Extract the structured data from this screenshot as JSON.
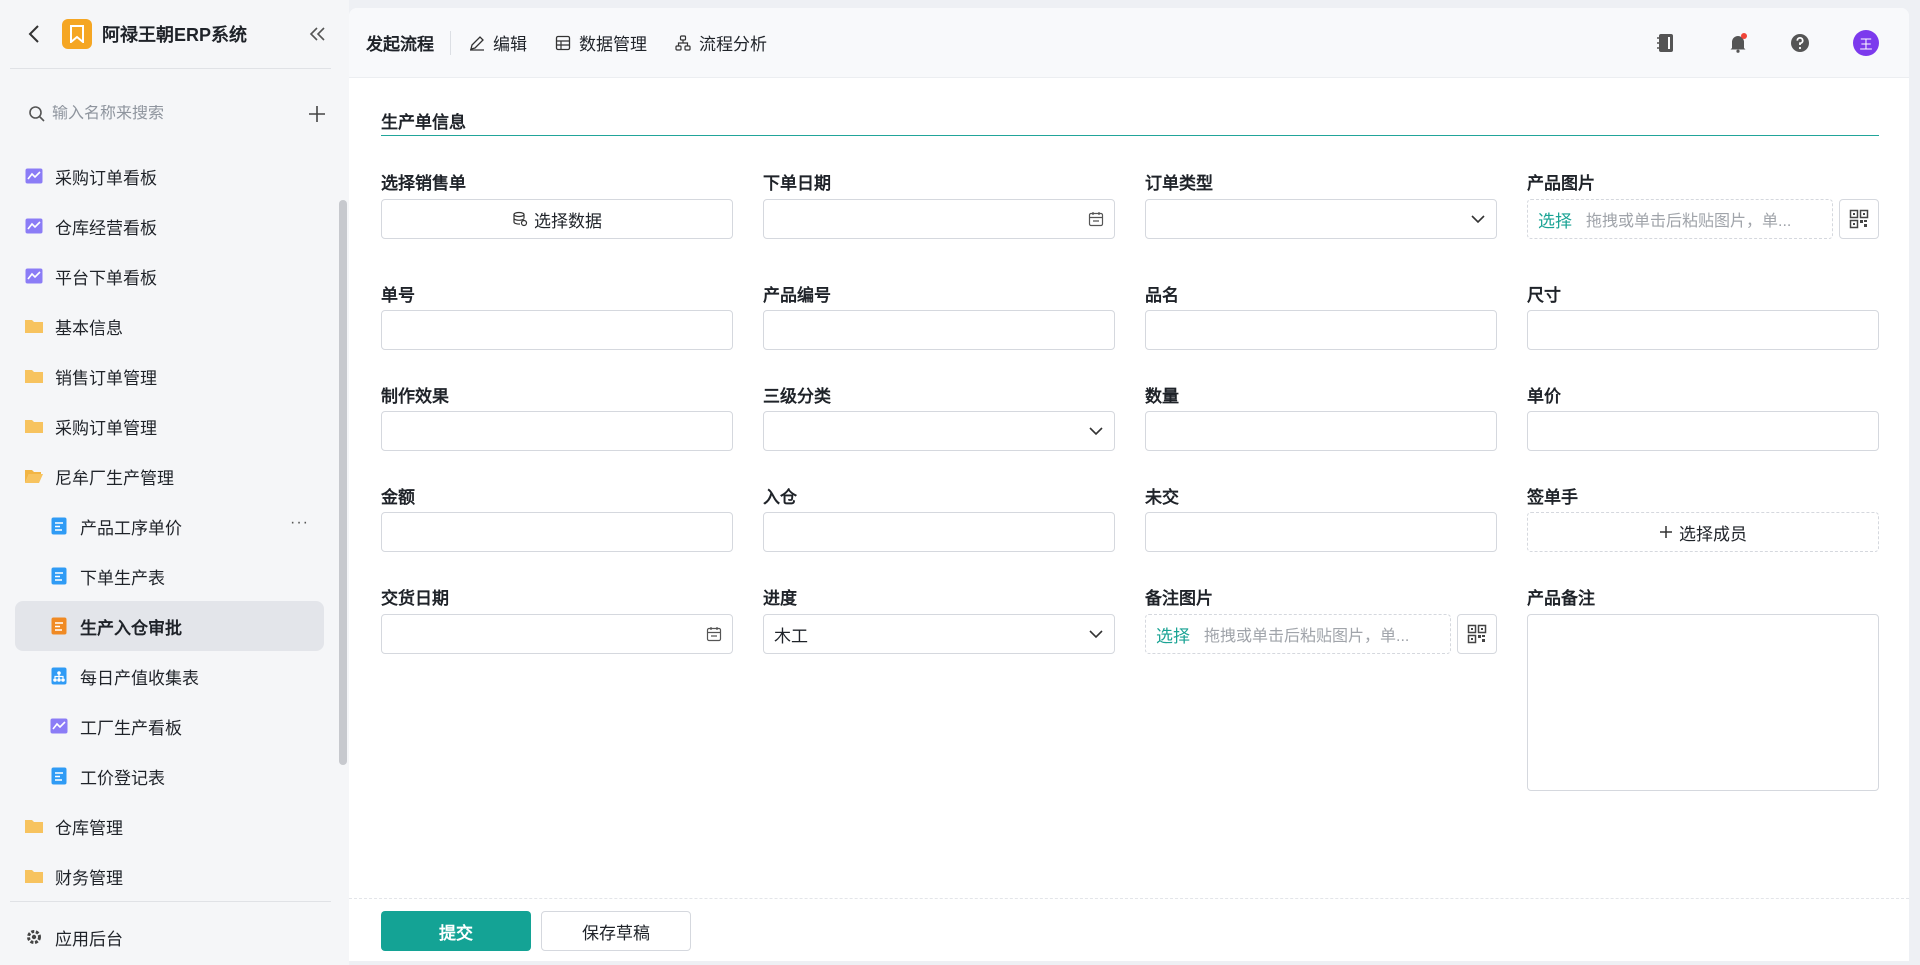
{
  "app": {
    "title": "阿禄王朝ERP系统"
  },
  "sidebar": {
    "search_placeholder": "输入名称来搜索",
    "items": [
      {
        "label": "采购订单看板",
        "icon": "chart-icon",
        "level": 0
      },
      {
        "label": "仓库经营看板",
        "icon": "chart-icon",
        "level": 0
      },
      {
        "label": "平台下单看板",
        "icon": "chart-icon",
        "level": 0
      },
      {
        "label": "基本信息",
        "icon": "folder-icon",
        "level": 0
      },
      {
        "label": "销售订单管理",
        "icon": "folder-icon",
        "level": 0
      },
      {
        "label": "采购订单管理",
        "icon": "folder-icon",
        "level": 0
      },
      {
        "label": "尼牟厂生产管理",
        "icon": "folder-open-icon",
        "level": 0
      },
      {
        "label": "产品工序单价",
        "icon": "form-icon",
        "level": 1
      },
      {
        "label": "下单生产表",
        "icon": "form-icon",
        "level": 1
      },
      {
        "label": "生产入仓审批",
        "icon": "approval-icon",
        "level": 1,
        "active": true
      },
      {
        "label": "每日产值收集表",
        "icon": "hierarchy-icon",
        "level": 1
      },
      {
        "label": "工厂生产看板",
        "icon": "chart-icon",
        "level": 1
      },
      {
        "label": "工价登记表",
        "icon": "form-icon",
        "level": 1
      },
      {
        "label": "仓库管理",
        "icon": "folder-icon",
        "level": 0
      },
      {
        "label": "财务管理",
        "icon": "folder-icon",
        "level": 0
      }
    ],
    "more_label": "···",
    "footer_label": "应用后台"
  },
  "topbar": {
    "tabs": [
      {
        "label": "发起流程"
      },
      {
        "label": "编辑",
        "icon": "pencil-icon"
      },
      {
        "label": "数据管理",
        "icon": "table-icon"
      },
      {
        "label": "流程分析",
        "icon": "flow-icon"
      }
    ],
    "avatar_text": "王"
  },
  "form": {
    "section_title": "生产单信息",
    "labels": {
      "sales_order": "选择销售单",
      "order_date": "下单日期",
      "order_type": "订单类型",
      "product_image": "产品图片",
      "order_no": "单号",
      "product_code": "产品编号",
      "product_name": "品名",
      "size": "尺寸",
      "effect": "制作效果",
      "category3": "三级分类",
      "quantity": "数量",
      "unit_price": "单价",
      "amount": "金额",
      "warehoused": "入仓",
      "undelivered": "未交",
      "signer": "签单手",
      "delivery_date": "交货日期",
      "progress": "进度",
      "remark_image": "备注图片",
      "product_remark": "产品备注"
    },
    "select_data_label": "选择数据",
    "upload_select": "选择",
    "upload_placeholder": "拖拽或单击后粘贴图片，单...",
    "select_member_label": "选择成员",
    "progress_value": "木工"
  },
  "actions": {
    "submit": "提交",
    "save_draft": "保存草稿"
  },
  "colors": {
    "accent": "#14a395",
    "logo": "#f5a623",
    "avatar": "#7c3aed"
  }
}
